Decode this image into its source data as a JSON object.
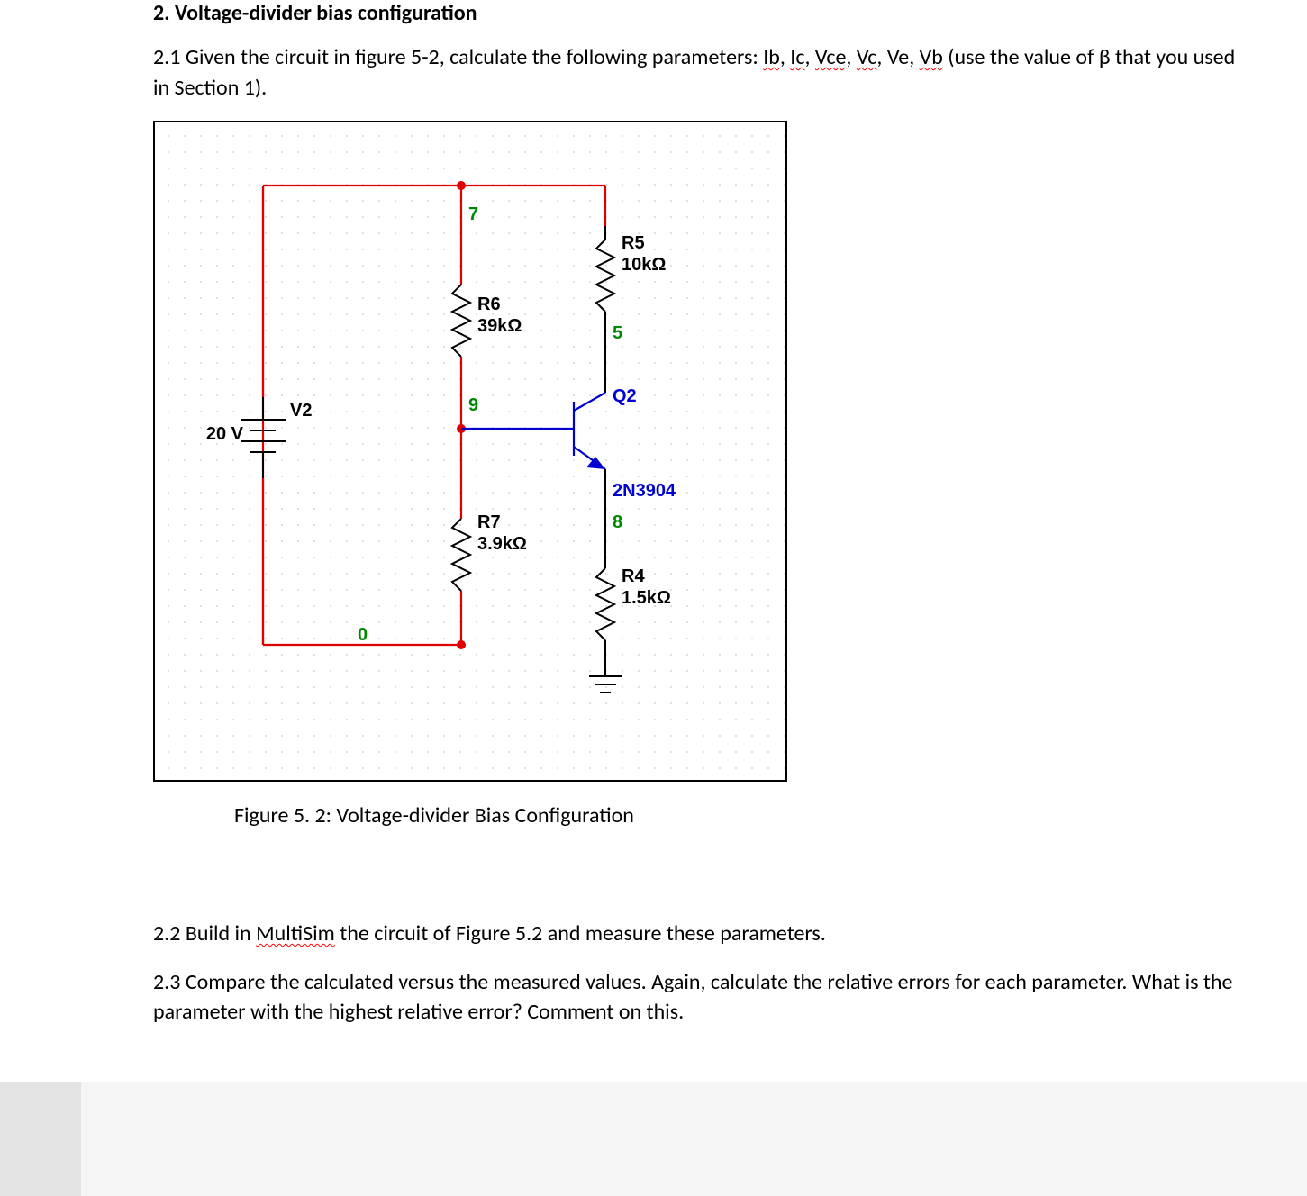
{
  "heading": "2. Voltage-divider bias configuration",
  "p21_a": "2.1 Given the circuit in figure 5-2, calculate the following parameters: ",
  "p21_b": " (use the value of β that you used in Section 1).",
  "params": {
    "ib": "Ib",
    "ic": "Ic",
    "vce": "Vce",
    "vc": "Vc",
    "ve": "Ve",
    "vb": "Vb"
  },
  "schem": {
    "nodes": {
      "n7": "7",
      "n9": "9",
      "n5": "5",
      "n8": "8",
      "n0": "0"
    },
    "v2": {
      "name": "V2",
      "val": "20 V"
    },
    "r5": {
      "name": "R5",
      "val": "10kΩ"
    },
    "r6": {
      "name": "R6",
      "val": "39kΩ"
    },
    "r7": {
      "name": "R7",
      "val": "3.9kΩ"
    },
    "r4": {
      "name": "R4",
      "val": "1.5kΩ"
    },
    "q2": {
      "name": "Q2",
      "part": "2N3904"
    }
  },
  "fig_caption": "Figure 5. 2:  Voltage-divider Bias Configuration",
  "p22_a": "2.2 Build in ",
  "p22_b": " the circuit of Figure 5.2 and measure these parameters.",
  "multisim": "MultiSim",
  "p23": "2.3 Compare the calculated versus the measured values.  Again, calculate the relative errors for each parameter. What is the parameter with the highest relative error?  Comment on this."
}
